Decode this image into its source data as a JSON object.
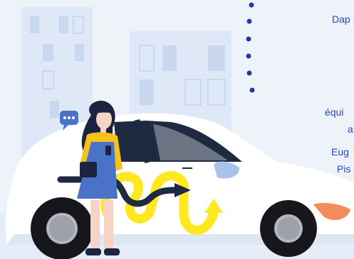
{
  "text_fragments": {
    "line1": "Dap",
    "line2": "",
    "line3": "équi",
    "line4": "a",
    "line5": "Eug",
    "line6": "Pis"
  },
  "colors": {
    "background": "#eef3fa",
    "building": "#dfe8f6",
    "window": "#c9d8ef",
    "car_body": "#ffffff",
    "car_shadow": "#dde6f3",
    "wheel_dark": "#16161c",
    "hub": "#b5b8c0",
    "accent_yellow": "#ffe81f",
    "arrow_dark": "#1d2a3f",
    "text_blue": "#2a47b8",
    "dots_blue": "#1f3aa6",
    "shirt_yellow": "#f5c21c",
    "dress_blue": "#4a73c7",
    "hair_dark": "#1c2340",
    "headlight_orange": "#f28c5a"
  },
  "icons": [
    "chat-bubble-icon",
    "arrow-right-icon",
    "arrow-up-icon"
  ]
}
